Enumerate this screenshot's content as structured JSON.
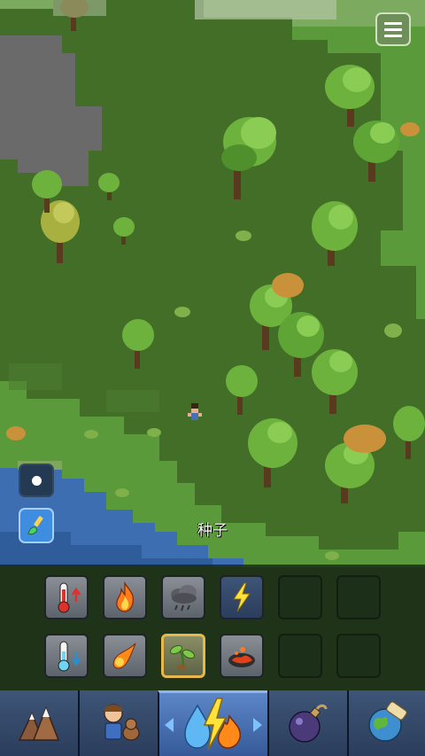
{
  "tool": {
    "selected_label": "种子"
  },
  "menu": {
    "icon": "menu-icon"
  },
  "brush": {
    "size_icon": "brush-size-dot-icon",
    "tool_icon": "brush-icon"
  },
  "powers": [
    {
      "name": "heat-up",
      "icon": "thermometer-up-icon"
    },
    {
      "name": "fire",
      "icon": "fire-icon"
    },
    {
      "name": "rain-cloud",
      "icon": "rain-cloud-icon"
    },
    {
      "name": "lightning",
      "icon": "lightning-icon"
    },
    {
      "name": "empty-1",
      "icon": ""
    },
    {
      "name": "empty-2",
      "icon": ""
    },
    {
      "name": "cool-down",
      "icon": "thermometer-down-icon"
    },
    {
      "name": "fireball",
      "icon": "fireball-icon"
    },
    {
      "name": "seed",
      "icon": "seed-sprout-icon",
      "selected": true
    },
    {
      "name": "lava",
      "icon": "lava-icon"
    },
    {
      "name": "empty-3",
      "icon": ""
    },
    {
      "name": "empty-4",
      "icon": ""
    }
  ],
  "tabs": [
    {
      "name": "terrain",
      "icon": "mountains-icon"
    },
    {
      "name": "creatures",
      "icon": "villager-dog-icon"
    },
    {
      "name": "powers",
      "icon": "drop-lightning-fire-icon",
      "active": true
    },
    {
      "name": "bombs",
      "icon": "bomb-icon"
    },
    {
      "name": "world",
      "icon": "globe-scroll-icon"
    }
  ]
}
